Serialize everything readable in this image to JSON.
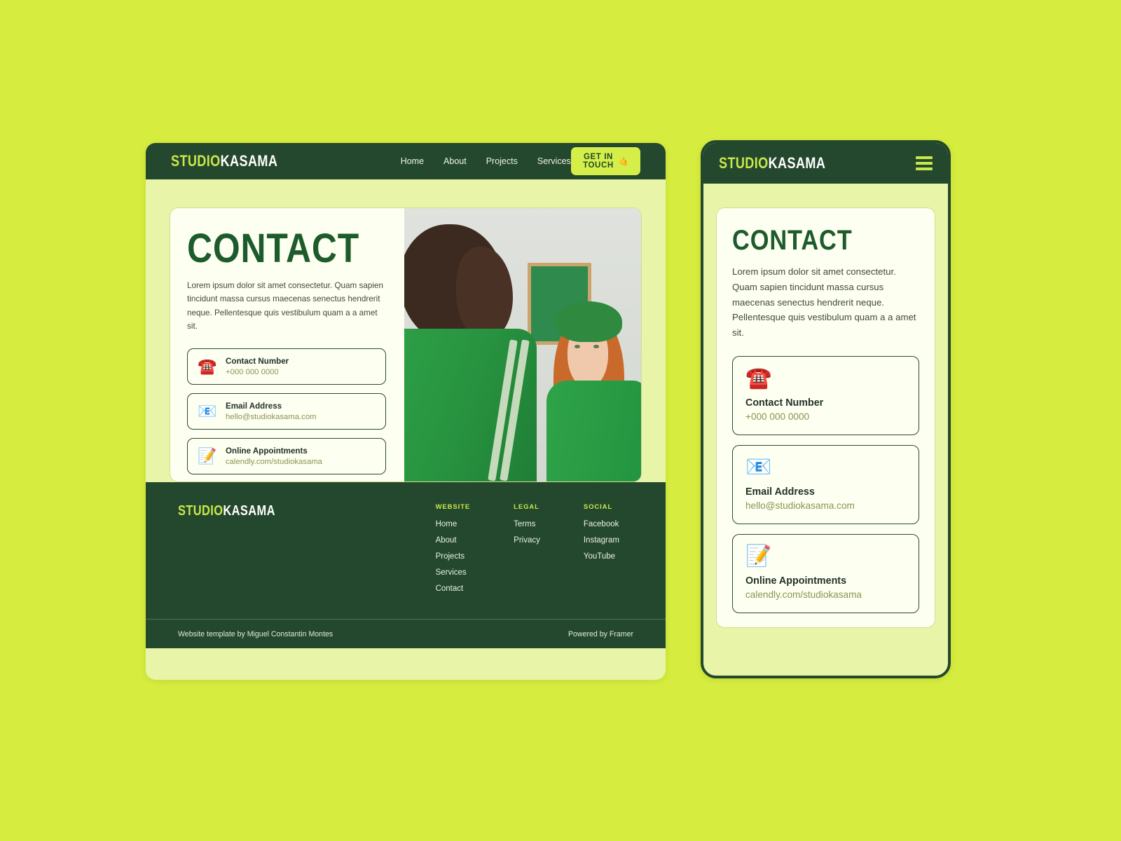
{
  "theme": {
    "page_background": "#d6ec3e",
    "surface": "#e8f5a8",
    "card": "#fdfff0",
    "dark_green": "#24482e",
    "lime": "#c9e84a",
    "heading_green": "#1d5b2c",
    "muted_olive": "#8a9552"
  },
  "brand": {
    "part1": "STUDIO",
    "part2": "KASAMA"
  },
  "desktop": {
    "nav": {
      "links": [
        {
          "label": "Home"
        },
        {
          "label": "About"
        },
        {
          "label": "Projects"
        },
        {
          "label": "Services"
        }
      ],
      "cta_label": "GET IN TOUCH",
      "cta_icon": "🤙"
    },
    "hero": {
      "title": "CONTACT",
      "lead": "Lorem ipsum dolor sit amet consectetur. Quam sapien tincidunt massa cursus maecenas senectus hendrerit neque. Pellentesque quis vestibulum quam a a amet sit."
    },
    "contact_items": [
      {
        "icon": "☎️",
        "icon_name": "telephone-icon",
        "title": "Contact Number",
        "value": "+000 000 0000"
      },
      {
        "icon": "📧",
        "icon_name": "email-icon",
        "title": "Email Address",
        "value": "hello@studiokasama.com"
      },
      {
        "icon": "📝",
        "icon_name": "memo-icon",
        "title": "Online Appointments",
        "value": "calendly.com/studiokasama"
      }
    ],
    "footer": {
      "columns": [
        {
          "heading": "WEBSITE",
          "links": [
            {
              "label": "Home"
            },
            {
              "label": "About"
            },
            {
              "label": "Projects"
            },
            {
              "label": "Services"
            },
            {
              "label": "Contact"
            }
          ]
        },
        {
          "heading": "LEGAL",
          "links": [
            {
              "label": "Terms"
            },
            {
              "label": "Privacy"
            }
          ]
        },
        {
          "heading": "SOCIAL",
          "links": [
            {
              "label": "Facebook"
            },
            {
              "label": "Instagram"
            },
            {
              "label": "YouTube"
            }
          ]
        }
      ],
      "credit_left": "Website template by Miguel Constantin Montes",
      "credit_right": "Powered by Framer"
    }
  },
  "mobile": {
    "menu_icon": "hamburger-icon",
    "hero": {
      "title": "CONTACT",
      "lead": "Lorem ipsum dolor sit amet consectetur. Quam sapien tincidunt massa cursus maecenas senectus hendrerit neque. Pellentesque quis vestibulum quam a a amet sit."
    },
    "contact_items": [
      {
        "icon": "☎️",
        "icon_name": "telephone-icon",
        "title": "Contact Number",
        "value": "+000 000 0000"
      },
      {
        "icon": "📧",
        "icon_name": "email-icon",
        "title": "Email Address",
        "value": "hello@studiokasama.com"
      },
      {
        "icon": "📝",
        "icon_name": "memo-icon",
        "title": "Online Appointments",
        "value": "calendly.com/studiokasama"
      }
    ]
  }
}
